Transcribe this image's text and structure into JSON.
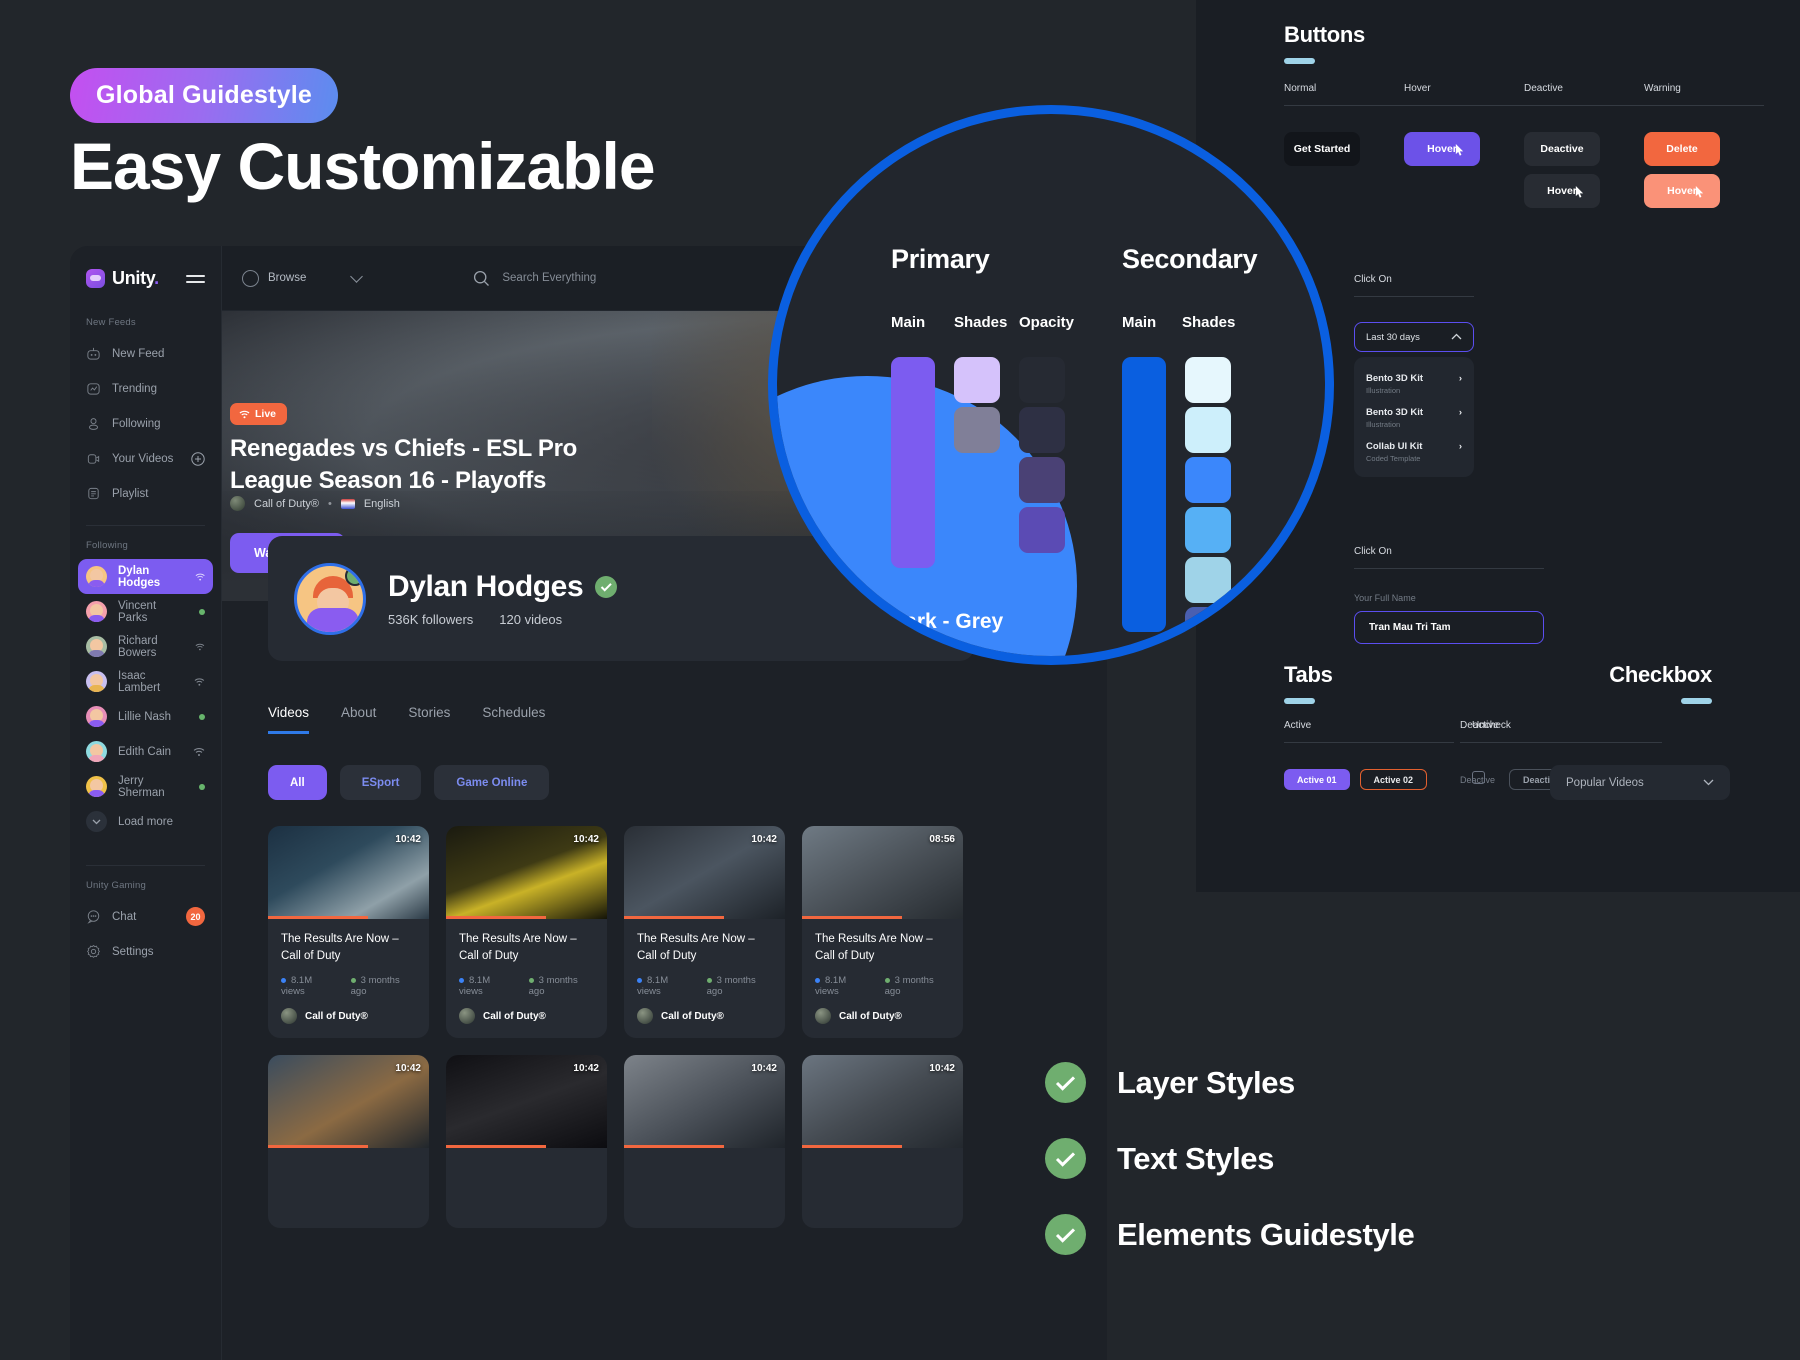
{
  "promo": {
    "badge": "Global Guidestyle",
    "title": "Easy Customizable"
  },
  "dashboard": {
    "brand": {
      "name": "Unity",
      "dot": "."
    },
    "sidebar": {
      "section_new_feeds": "New Feeds",
      "nav": [
        {
          "label": "New Feed",
          "icon": "feed-icon"
        },
        {
          "label": "Trending",
          "icon": "trending-icon"
        },
        {
          "label": "Following",
          "icon": "user-icon"
        },
        {
          "label": "Your Videos",
          "icon": "video-icon",
          "trailing": "plus-icon"
        },
        {
          "label": "Playlist",
          "icon": "playlist-icon"
        }
      ],
      "section_following": "Following",
      "following": [
        {
          "name": "Dylan Hodges",
          "status": "wifi",
          "active": true
        },
        {
          "name": "Vincent Parks",
          "status": "dot"
        },
        {
          "name": "Richard Bowers",
          "status": "wifi"
        },
        {
          "name": "Isaac Lambert",
          "status": "wifi"
        },
        {
          "name": "Lillie Nash",
          "status": "dot"
        },
        {
          "name": "Edith Cain",
          "status": "wifi"
        },
        {
          "name": "Jerry Sherman",
          "status": "dot"
        }
      ],
      "load_more": "Load more",
      "section_unity_gaming": "Unity Gaming",
      "bottom": [
        {
          "label": "Chat",
          "badge": "20"
        },
        {
          "label": "Settings",
          "badge": ""
        }
      ]
    },
    "topbar": {
      "browse": "Browse",
      "search_placeholder": "Search Everything"
    },
    "hero": {
      "live": "Live",
      "title": "Renegades vs Chiefs - ESL Pro League Season 16 - Playoffs",
      "game": "Call of Duty®",
      "language": "English",
      "watch_button": "Watch Now"
    },
    "profile": {
      "name": "Dylan Hodges",
      "followers": "536K followers",
      "videos": "120 videos"
    },
    "content_tabs": [
      {
        "label": "Videos",
        "active": true
      },
      {
        "label": "About",
        "active": false
      },
      {
        "label": "Stories",
        "active": false
      },
      {
        "label": "Schedules",
        "active": false
      }
    ],
    "filters": [
      {
        "label": "All",
        "active": true
      },
      {
        "label": "ESport",
        "active": false
      },
      {
        "label": "Game Online",
        "active": false
      }
    ],
    "sort": "Popular Videos",
    "videos": [
      {
        "duration": "10:42",
        "title": "The Results Are Now – Call of Duty",
        "views": "8.1M views",
        "age": "3 months ago",
        "channel": "Call of Duty®",
        "thumb": "t1"
      },
      {
        "duration": "10:42",
        "title": "The Results Are Now – Call of Duty",
        "views": "8.1M views",
        "age": "3 months ago",
        "channel": "Call of Duty®",
        "thumb": "t2"
      },
      {
        "duration": "10:42",
        "title": "The Results Are Now – Call of Duty",
        "views": "8.1M views",
        "age": "3 months ago",
        "channel": "Call of Duty®",
        "thumb": "t3"
      },
      {
        "duration": "08:56",
        "title": "The Results Are Now – Call of Duty",
        "views": "8.1M views",
        "age": "3 months ago",
        "channel": "Call of Duty®",
        "thumb": "t4"
      },
      {
        "duration": "10:42",
        "title": "",
        "views": "",
        "age": "",
        "channel": "",
        "thumb": "t5"
      },
      {
        "duration": "10:42",
        "title": "",
        "views": "",
        "age": "",
        "channel": "",
        "thumb": "t6"
      },
      {
        "duration": "10:42",
        "title": "",
        "views": "",
        "age": "",
        "channel": "",
        "thumb": "t7"
      },
      {
        "duration": "10:42",
        "title": "",
        "views": "",
        "age": "",
        "channel": "",
        "thumb": "t8"
      }
    ]
  },
  "guide": {
    "buttons": {
      "title": "Buttons",
      "columns": [
        {
          "head": "Normal",
          "items": [
            {
              "label": "Get Started",
              "style": "normal"
            }
          ]
        },
        {
          "head": "Hover",
          "items": [
            {
              "label": "Hover",
              "style": "hover"
            }
          ]
        },
        {
          "head": "Deactive",
          "items": [
            {
              "label": "Deactive",
              "style": "deactive"
            },
            {
              "label": "Hover",
              "style": "deactive-hover"
            }
          ]
        },
        {
          "head": "Warning",
          "items": [
            {
              "label": "Delete",
              "style": "warning"
            },
            {
              "label": "Hover",
              "style": "warning-hover"
            }
          ]
        }
      ]
    },
    "dropdown": {
      "click_on": "Click On",
      "selected": "Last 30 days",
      "options": [
        {
          "title": "Bento 3D Kit",
          "sub": "Illustration"
        },
        {
          "title": "Bento 3D Kit",
          "sub": "Illustration"
        },
        {
          "title": "Collab UI Kit",
          "sub": "Coded Template"
        }
      ]
    },
    "input": {
      "click_on": "Click On",
      "label": "Your Full Name",
      "value": "Tran Mau Tri Tam"
    },
    "tabs": {
      "title": "Tabs",
      "active_head": "Active",
      "deactive_head": "Deactive",
      "active_items": [
        "Active 01",
        "Active 02"
      ],
      "deactive_items": [
        "Deactive",
        "Deactive"
      ]
    },
    "checkbox": {
      "title": "Checkbox",
      "head": "Uncheck"
    }
  },
  "magnifier": {
    "primary": "Primary",
    "secondary": "Secondary",
    "cols": {
      "main": "Main",
      "shades": "Shades",
      "opacity": "Opacity"
    },
    "dark_grey": "Dark - Grey",
    "colors": {
      "primary_main": "#7c5cf0",
      "primary_shades": [
        "#d5c2fb",
        "#807f98"
      ],
      "primary_opacity": [
        "#262a33",
        "#2e3044",
        "#4a4175",
        "#5b4bb4"
      ],
      "secondary_main": "#0a5fe0",
      "secondary_shades": [
        "#e6f7fd",
        "#cdeffb",
        "#3b87fb",
        "#56b0f5",
        "#9fd3e8",
        "#4a5fb0"
      ]
    }
  },
  "features": [
    {
      "label": "Layer Styles"
    },
    {
      "label": "Text Styles"
    },
    {
      "label": "Elements Guidestyle"
    }
  ]
}
